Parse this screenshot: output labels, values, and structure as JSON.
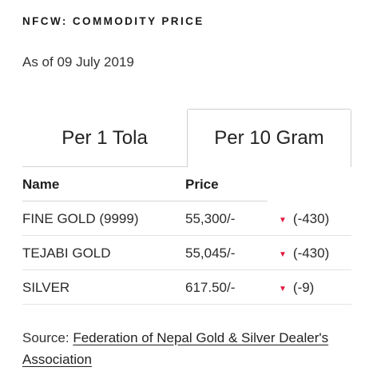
{
  "widget": {
    "title": "NFCW: COMMODITY PRICE",
    "as_of": "As of 09 July 2019"
  },
  "tabs": [
    {
      "label": "Per 1 Tola",
      "active": false
    },
    {
      "label": "Per 10 Gram",
      "active": true
    }
  ],
  "table": {
    "headers": {
      "name": "Name",
      "price": "Price"
    },
    "rows": [
      {
        "name": "FINE GOLD (9999)",
        "price": "55,300/-",
        "change": "(-430)",
        "direction": "down"
      },
      {
        "name": "TEJABI GOLD",
        "price": "55,045/-",
        "change": "(-430)",
        "direction": "down"
      },
      {
        "name": "SILVER",
        "price": "617.50/-",
        "change": "(-9)",
        "direction": "down"
      }
    ]
  },
  "source": {
    "prefix": "Source: ",
    "link_text": "Federation of Nepal Gold & Silver Dealer's Association"
  },
  "colors": {
    "down_indicator": "#e0173c"
  }
}
